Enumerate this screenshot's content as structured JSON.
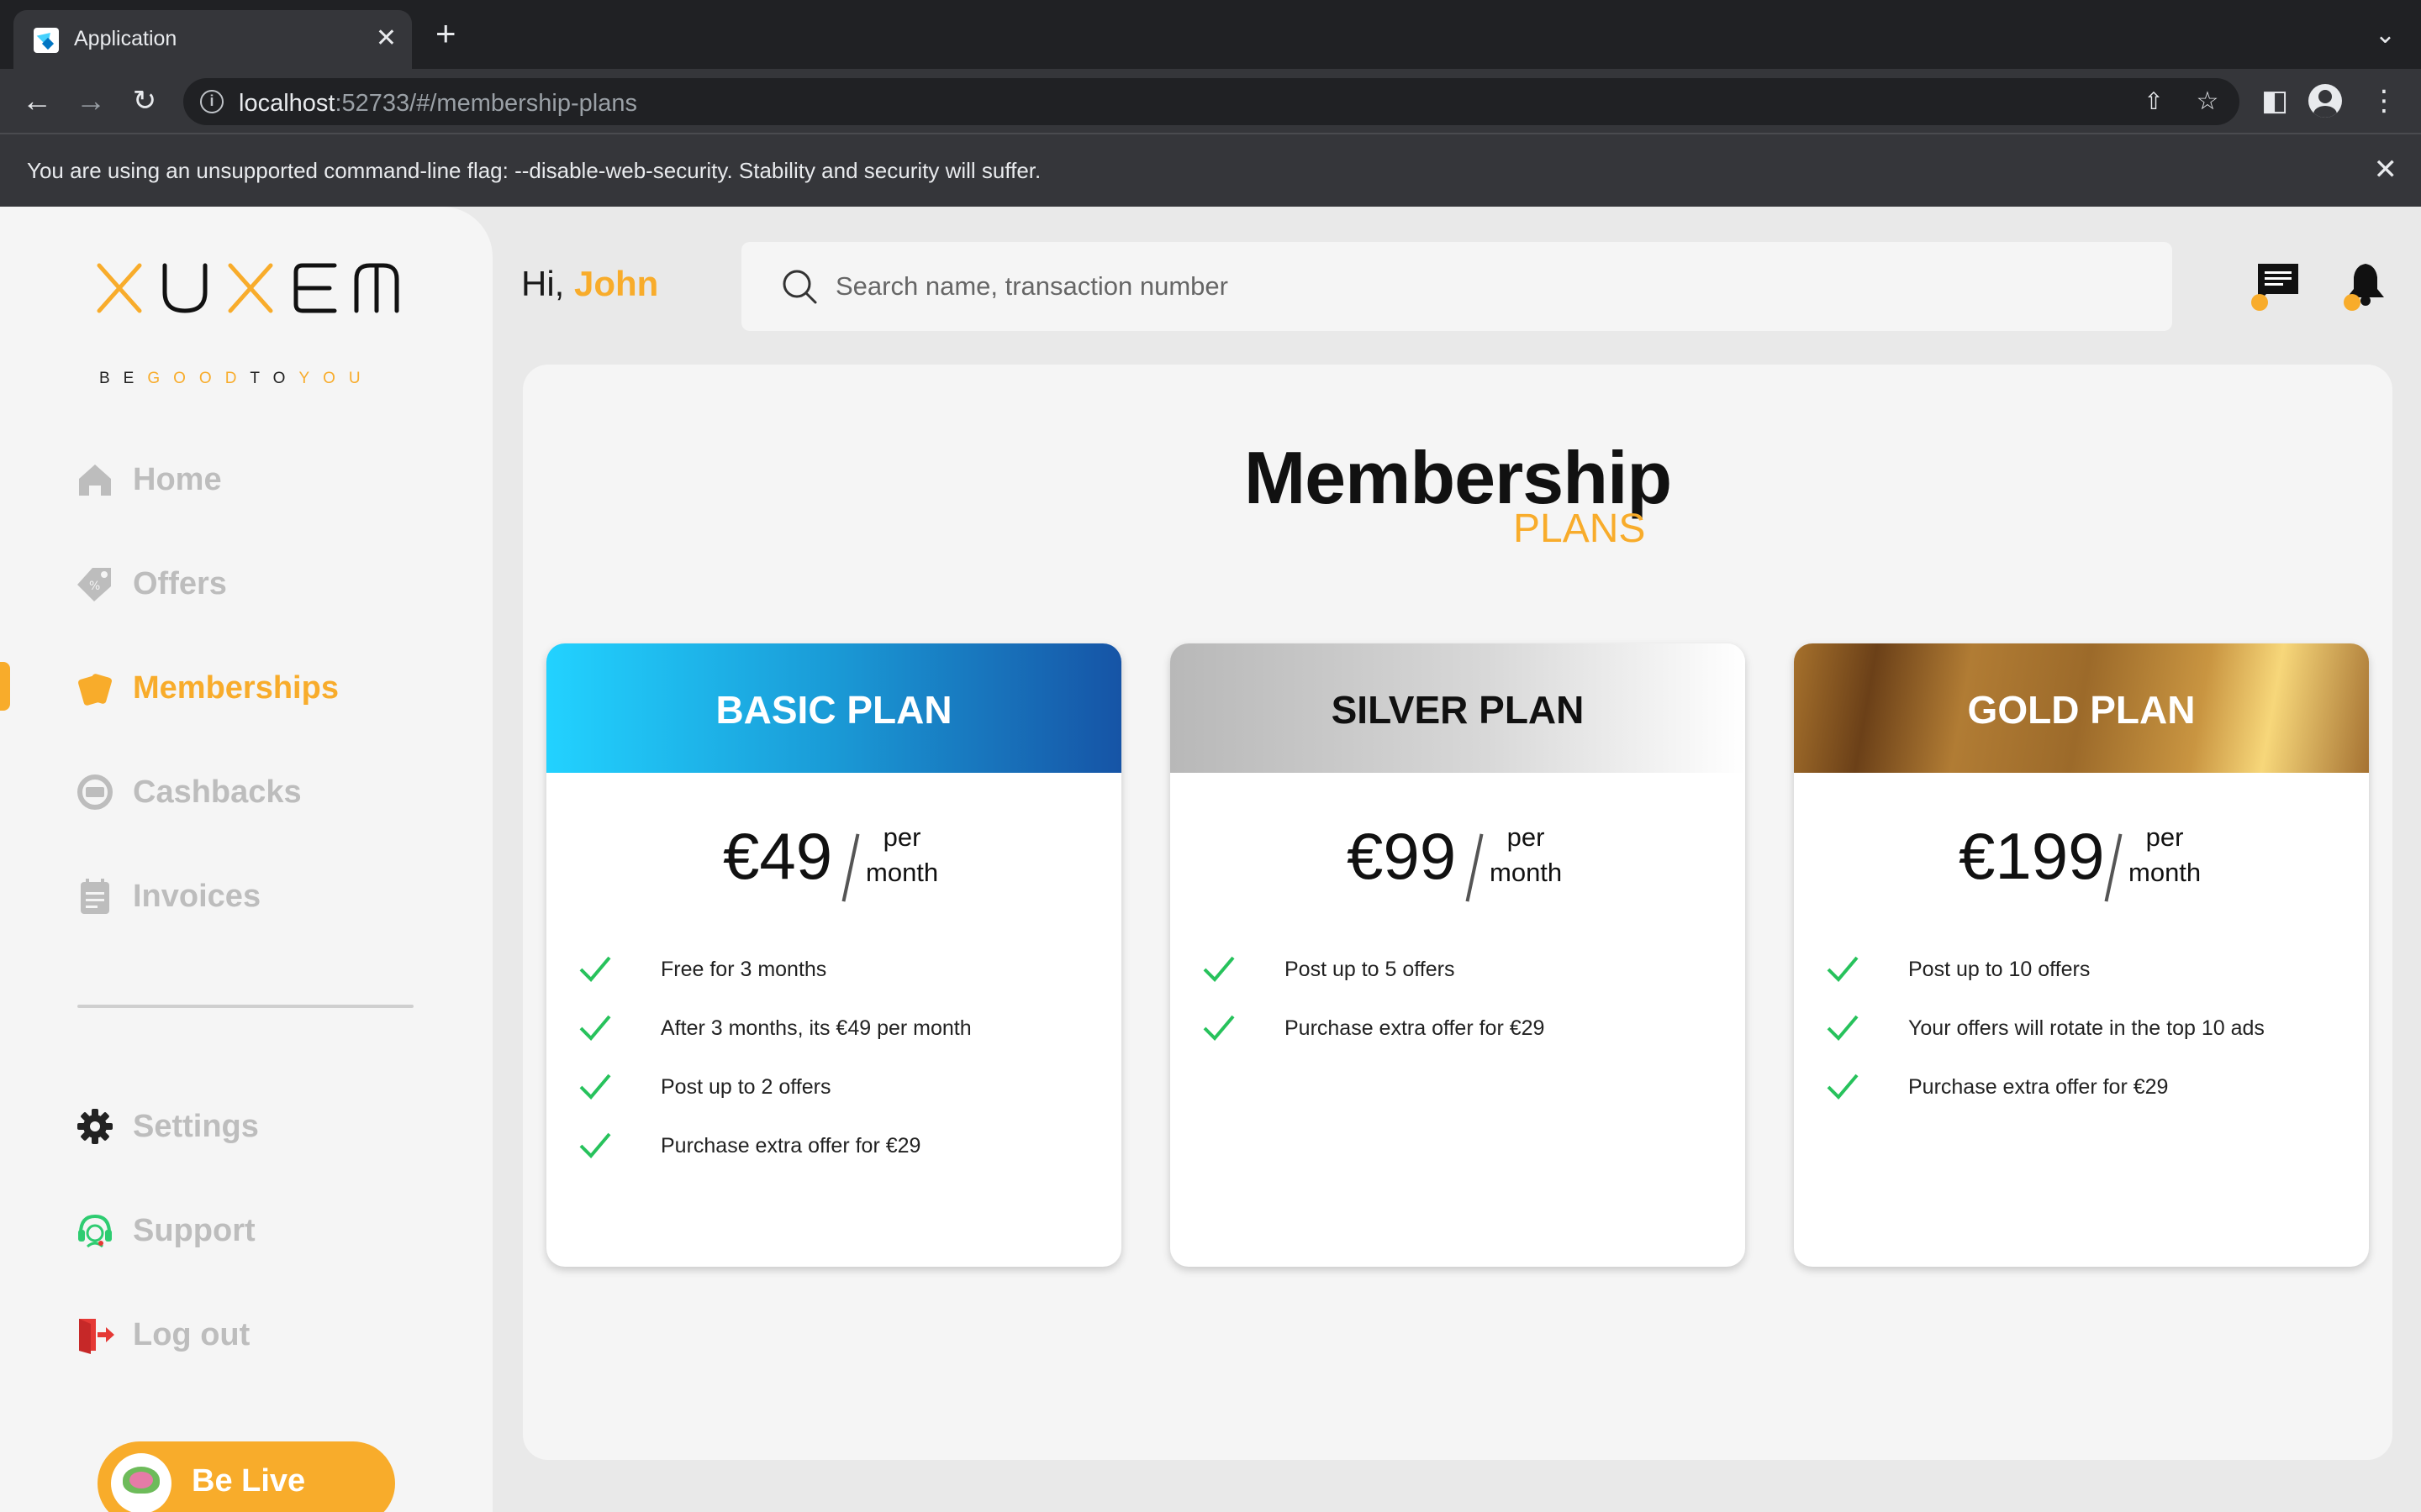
{
  "browser": {
    "tab_title": "Application",
    "tab_close": "✕",
    "new_tab": "+",
    "tab_dropdown": "⌄",
    "url_host": "localhost",
    "url_rest": ":52733/#/membership-plans",
    "infobar_text": "You are using an unsupported command-line flag: --disable-web-security. Stability and security will suffer.",
    "infobar_close": "✕"
  },
  "sidebar": {
    "logo_text": "XUXEM",
    "logo_tagline": [
      "BE",
      "GOOD",
      "TO",
      "YOU"
    ],
    "items": [
      {
        "label": "Home",
        "icon": "home-icon"
      },
      {
        "label": "Offers",
        "icon": "tag-icon"
      },
      {
        "label": "Memberships",
        "icon": "card-icon",
        "active": true
      },
      {
        "label": "Cashbacks",
        "icon": "cashback-icon"
      },
      {
        "label": "Invoices",
        "icon": "invoice-icon"
      },
      {
        "label": "Settings",
        "icon": "gear-icon"
      },
      {
        "label": "Support",
        "icon": "headset-icon"
      },
      {
        "label": "Log out",
        "icon": "logout-icon"
      }
    ],
    "be_live_label": "Be Live"
  },
  "header": {
    "greeting": "Hi,",
    "user_name": "John",
    "search_placeholder": "Search name, transaction number"
  },
  "main": {
    "title": "Membership",
    "subtitle": "PLANS",
    "plans": [
      {
        "name": "BASIC PLAN",
        "price": "€49",
        "per": "per",
        "period": "month",
        "features": [
          "Free for 3 months",
          "After 3 months, its €49 per month",
          "Post up to 2 offers",
          "Purchase extra offer for €29"
        ]
      },
      {
        "name": "SILVER PLAN",
        "price": "€99",
        "per": "per",
        "period": "month",
        "features": [
          "Post up to 5 offers",
          "Purchase extra offer for €29"
        ]
      },
      {
        "name": "GOLD PLAN",
        "price": "€199",
        "per": "per",
        "period": "month",
        "features": [
          "Post up to 10 offers",
          "Your offers will rotate in the top 10 ads",
          "Purchase extra offer for €29"
        ]
      }
    ]
  },
  "colors": {
    "accent": "#f8ac2b",
    "check": "#27c25c",
    "nav_inactive": "#bdbdbd",
    "basic_gradient": [
      "#22d2ff",
      "#1654a6"
    ],
    "silver_gradient": [
      "#b8b8b8",
      "#ffffff"
    ],
    "gold_gradient": [
      "#6b4018",
      "#f7d77a"
    ]
  }
}
